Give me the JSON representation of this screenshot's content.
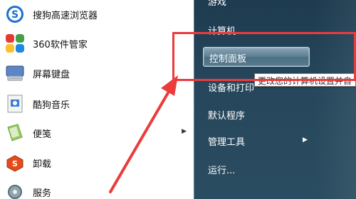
{
  "left_items": [
    {
      "label": "搜狗高速浏览器",
      "icon": "sogou-browser-icon",
      "has_arrow": false
    },
    {
      "label": "360软件管家",
      "icon": "360-software-manager-icon",
      "has_arrow": false
    },
    {
      "label": "屏幕键盘",
      "icon": "keyboard-icon",
      "has_arrow": false
    },
    {
      "label": "酷狗音乐",
      "icon": "kugou-music-icon",
      "has_arrow": false
    },
    {
      "label": "便笺",
      "icon": "sticky-notes-icon",
      "has_arrow": true
    },
    {
      "label": "卸载",
      "icon": "uninstall-icon",
      "has_arrow": false
    },
    {
      "label": "服务",
      "icon": "services-icon",
      "has_arrow": false
    }
  ],
  "right_items": {
    "games": "游戏",
    "computer": "计算机",
    "control_panel": "控制面板",
    "devices": "设备和打印",
    "default_programs": "默认程序",
    "admin_tools": "管理工具",
    "run": "运行..."
  },
  "tooltip": "更改您的计算机设置并自",
  "colors": {
    "annotation": "#ec3b3b",
    "right_pane": "#25465b",
    "highlight": "#5d7f93"
  }
}
